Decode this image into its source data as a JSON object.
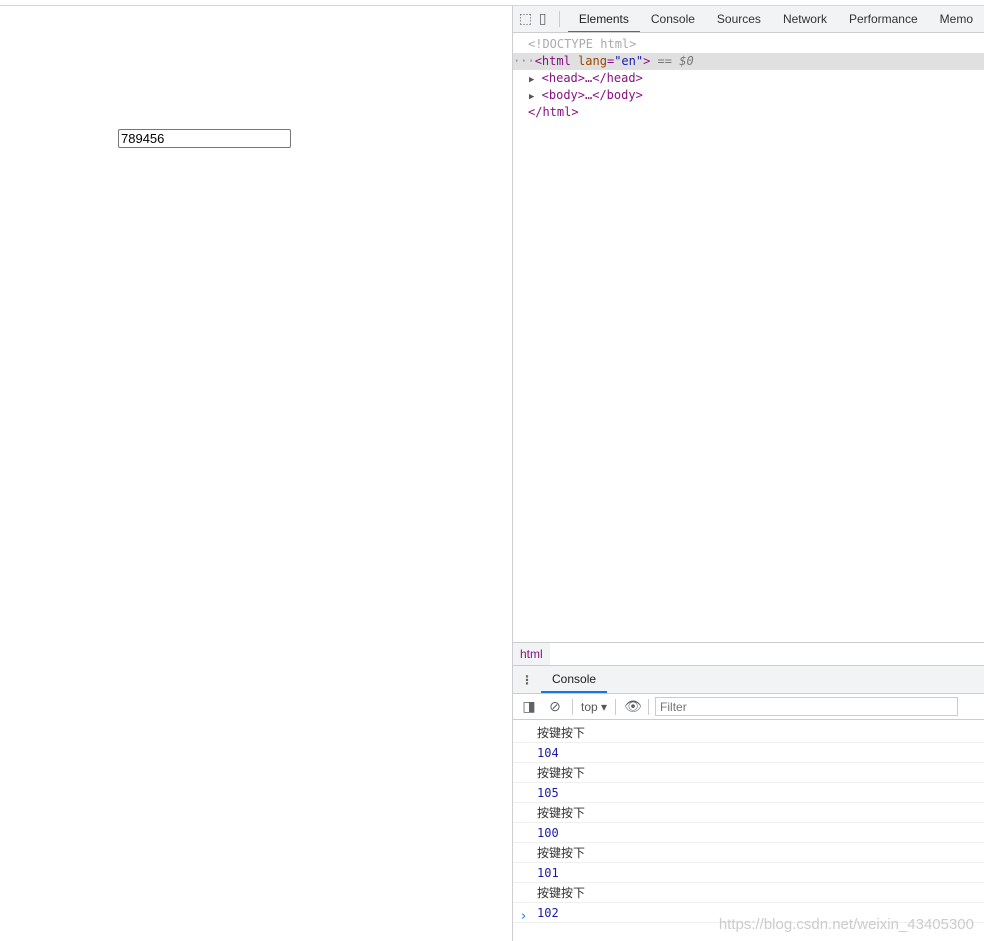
{
  "page": {
    "input_value": "789456"
  },
  "devtools": {
    "tabs": [
      "Elements",
      "Console",
      "Sources",
      "Network",
      "Performance",
      "Memo"
    ],
    "tree": {
      "doctype": "<!DOCTYPE html>",
      "html_open": "<html",
      "lang_attr": "lang",
      "lang_val": "\"en\"",
      "close": ">",
      "selected_marker": " == $0",
      "head": "<head>…</head>",
      "body": "<body>…</body>",
      "html_close": "</html>"
    },
    "breadcrumb": "html",
    "drawer_tab": "Console",
    "context": "top",
    "filter_placeholder": "Filter",
    "log": [
      {
        "text": "按键按下",
        "kind": "text"
      },
      {
        "text": "104",
        "kind": "num"
      },
      {
        "text": "按键按下",
        "kind": "text"
      },
      {
        "text": "105",
        "kind": "num"
      },
      {
        "text": "按键按下",
        "kind": "text"
      },
      {
        "text": "100",
        "kind": "num"
      },
      {
        "text": "按键按下",
        "kind": "text"
      },
      {
        "text": "101",
        "kind": "num"
      },
      {
        "text": "按键按下",
        "kind": "text"
      },
      {
        "text": "102",
        "kind": "num"
      }
    ],
    "prompt": "›"
  },
  "watermark": "https://blog.csdn.net/weixin_43405300",
  "colors": {
    "accent": "#1a73e8",
    "tag": "#881280",
    "number": "#1a1aa6"
  }
}
